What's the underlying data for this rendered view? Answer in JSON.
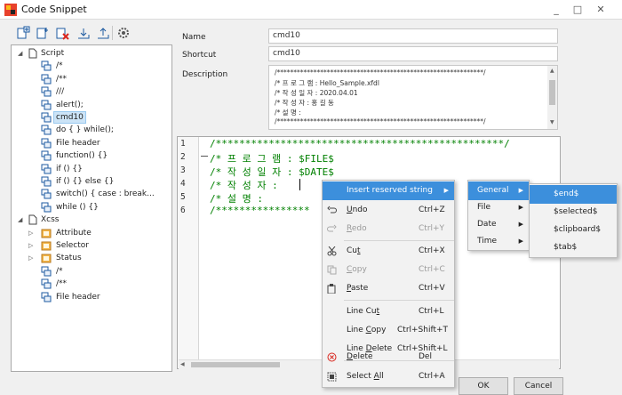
{
  "window": {
    "title": "Code Snippet",
    "minimize": "_",
    "maximize": "□",
    "close": "✕"
  },
  "toolbar": {
    "icons": [
      "add-snippet-icon",
      "add-child-icon",
      "delete-icon",
      "import-icon",
      "export-icon",
      "settings-icon"
    ]
  },
  "tree": {
    "rows": [
      {
        "label": "Script",
        "type": "folder",
        "expanded": true
      },
      {
        "label": "/*",
        "type": "item"
      },
      {
        "label": "/**",
        "type": "item"
      },
      {
        "label": "///",
        "type": "item"
      },
      {
        "label": "alert();",
        "type": "item"
      },
      {
        "label": "cmd10",
        "type": "item",
        "selected": true
      },
      {
        "label": "do { } while();",
        "type": "item"
      },
      {
        "label": "File header",
        "type": "item"
      },
      {
        "label": "function() {}",
        "type": "item"
      },
      {
        "label": "if () {}",
        "type": "item"
      },
      {
        "label": "if () {} else {}",
        "type": "item"
      },
      {
        "label": "switch() { case : break...",
        "type": "item"
      },
      {
        "label": "while () {}",
        "type": "item"
      },
      {
        "label": "Xcss",
        "type": "folder",
        "expanded": true
      },
      {
        "label": "Attribute",
        "type": "subfolder"
      },
      {
        "label": "Selector",
        "type": "subfolder"
      },
      {
        "label": "Status",
        "type": "subfolder"
      },
      {
        "label": "/*",
        "type": "item"
      },
      {
        "label": "/**",
        "type": "item"
      },
      {
        "label": "File header",
        "type": "item"
      }
    ]
  },
  "form": {
    "name_label": "Name",
    "name_value": "cmd10",
    "shortcut_label": "Shortcut",
    "shortcut_value": "cmd10",
    "description_label": "Description",
    "description_lines": [
      "/**************************************************************/",
      "/* 프 로 그 램 : Hello_Sample.xfdl",
      "/* 작 성 일 자 : 2020.04.01",
      "/* 작 성  자 : 홍 길 동",
      "/* 설      명 :",
      "/**************************************************************/"
    ]
  },
  "editor": {
    "line_numbers": [
      "1",
      "2",
      "3",
      "4",
      "5",
      "6"
    ],
    "lines": [
      "/*************************************************/",
      "/* 프 로 그 램 : $FILE$",
      "/* 작 성 일 자 : $DATE$",
      "/* 작  성   자 :",
      "/* 설      명 :",
      "/****************"
    ]
  },
  "buttons": {
    "ok": "OK",
    "cancel": "Cancel"
  },
  "context_menu": {
    "items": [
      {
        "label": "Insert reserved string",
        "shortcut": "",
        "submenu": true,
        "highlighted": true
      },
      {
        "label": "Undo",
        "shortcut": "Ctrl+Z",
        "icon": "undo-icon"
      },
      {
        "label": "Redo",
        "shortcut": "Ctrl+Y",
        "icon": "redo-icon",
        "disabled": true
      },
      {
        "label": "Cut",
        "shortcut": "Ctrl+X",
        "icon": "cut-icon"
      },
      {
        "label": "Copy",
        "shortcut": "Ctrl+C",
        "icon": "copy-icon",
        "disabled": true
      },
      {
        "label": "Paste",
        "shortcut": "Ctrl+V",
        "icon": "paste-icon"
      },
      {
        "label": "Line Cut",
        "shortcut": "Ctrl+L"
      },
      {
        "label": "Line Copy",
        "shortcut": "Ctrl+Shift+T"
      },
      {
        "label": "Line Delete",
        "shortcut": "Ctrl+Shift+L"
      },
      {
        "label": "Delete",
        "shortcut": "Del",
        "icon": "delete-icon"
      },
      {
        "label": "Select All",
        "shortcut": "Ctrl+A",
        "icon": "select-all-icon"
      }
    ]
  },
  "submenu1": {
    "items": [
      {
        "label": "General",
        "highlighted": true
      },
      {
        "label": "File"
      },
      {
        "label": "Date"
      },
      {
        "label": "Time"
      }
    ]
  },
  "submenu2": {
    "items": [
      {
        "label": "$end$",
        "highlighted": true
      },
      {
        "label": "$selected$"
      },
      {
        "label": "$clipboard$"
      },
      {
        "label": "$tab$"
      }
    ]
  },
  "colors": {
    "accent": "#3c8fdc",
    "code_green": "#008000",
    "selection": "#cce4f7"
  }
}
